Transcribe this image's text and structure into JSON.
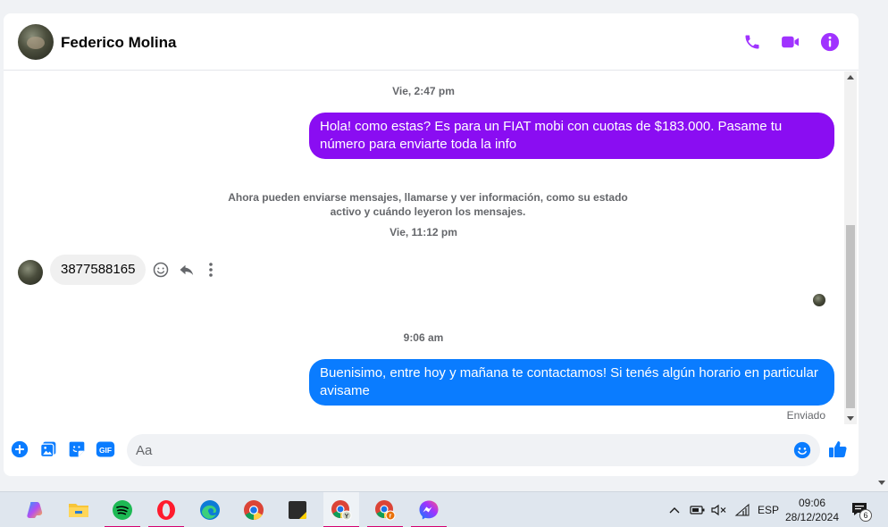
{
  "header": {
    "contact_name": "Federico Molina"
  },
  "messages": {
    "ts1": "Vie, 2:47 pm",
    "out1": "Hola! como estas? Es para un FIAT mobi con cuotas de $183.000. Pasame tu número para enviarte toda la info",
    "system_note": "Ahora pueden enviarse mensajes, llamarse y ver información, como su estado activo y cuándo leyeron los mensajes.",
    "ts2": "Vie, 11:12 pm",
    "in1": "3877588165",
    "ts3": "9:06 am",
    "out2": "Buenisimo, entre hoy y mañana te contactamos! Si tenés algún horario en particular avisame",
    "status": "Enviado"
  },
  "composer": {
    "placeholder": "Aa"
  },
  "taskbar": {
    "language": "ESP",
    "time": "09:06",
    "date": "28/12/2024",
    "notifications": "6",
    "apps": [
      "copilot",
      "file-explorer",
      "spotify",
      "opera",
      "edge",
      "chrome",
      "sticky-notes",
      "chrome-profile-y",
      "chrome-profile-r",
      "messenger"
    ]
  },
  "colors": {
    "accent_purple": "#8a0df2",
    "bubble_blue": "#0a7cff",
    "icon_purple": "#a033ff",
    "icon_blue": "#0a7cff"
  }
}
